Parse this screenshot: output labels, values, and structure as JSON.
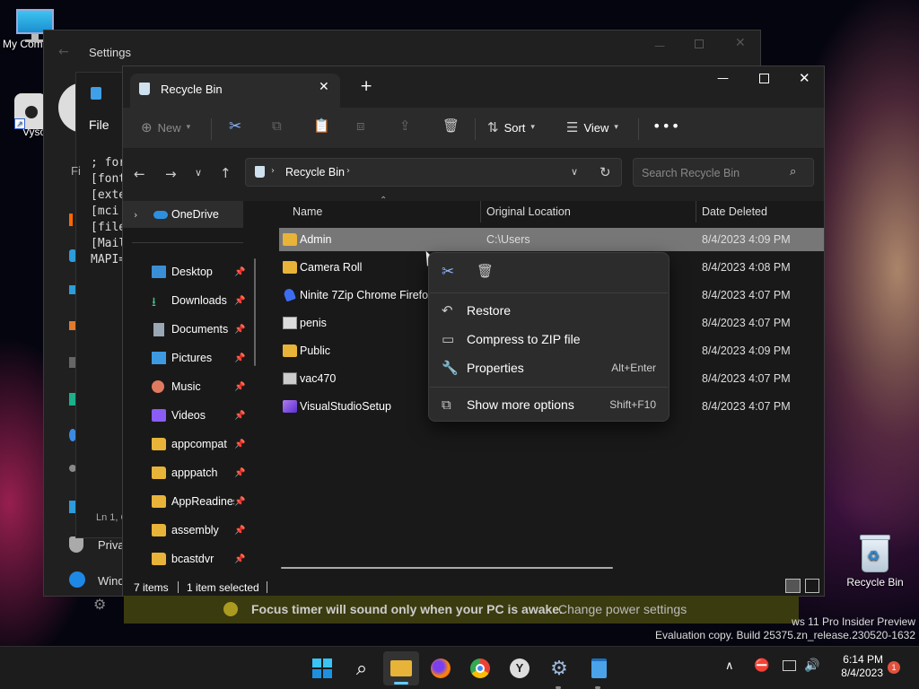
{
  "desktop": {
    "icons": [
      {
        "label": "My Com"
      },
      {
        "label": "Vyso"
      },
      {
        "label": "Recycle Bin"
      }
    ],
    "watermark_line1": "ws 11 Pro Insider Preview",
    "watermark_line2": "Evaluation copy. Build 25375.zn_release.230520-1632"
  },
  "settings_window": {
    "title": "Settings",
    "sidebar_fragments": [
      "Priva",
      "Wind"
    ]
  },
  "notepad_window": {
    "menu_file": "File",
    "menu_fi": "Fi",
    "lines": [
      "; for",
      "[font",
      "[exte",
      "[mci",
      "[file",
      "[Mail",
      "MAPI="
    ],
    "status": "Ln 1, C"
  },
  "explorer": {
    "tab_title": "Recycle Bin",
    "toolbar": {
      "new_label": "New",
      "sort_label": "Sort",
      "view_label": "View"
    },
    "address": {
      "path": "Recycle Bin",
      "search_placeholder": "Search Recycle Bin"
    },
    "nav": {
      "onedrive": "OneDrive",
      "items": [
        {
          "label": "Desktop",
          "icon": "desktop-icon"
        },
        {
          "label": "Downloads",
          "icon": "download-icon"
        },
        {
          "label": "Documents",
          "icon": "document-icon"
        },
        {
          "label": "Pictures",
          "icon": "picture-icon"
        },
        {
          "label": "Music",
          "icon": "music-icon"
        },
        {
          "label": "Videos",
          "icon": "video-icon"
        },
        {
          "label": "appcompat",
          "icon": "folder-icon"
        },
        {
          "label": "apppatch",
          "icon": "folder-icon"
        },
        {
          "label": "AppReadiness",
          "icon": "folder-icon"
        },
        {
          "label": "assembly",
          "icon": "folder-icon"
        },
        {
          "label": "bcastdvr",
          "icon": "folder-icon"
        }
      ]
    },
    "columns": {
      "name": "Name",
      "location": "Original Location",
      "date": "Date Deleted"
    },
    "rows": [
      {
        "name": "Admin",
        "location": "C:\\Users",
        "date": "8/4/2023 4:09 PM",
        "icon": "folder-icon"
      },
      {
        "name": "Camera Roll",
        "location": "",
        "date": "8/4/2023 4:08 PM",
        "icon": "folder-icon"
      },
      {
        "name": "Ninite 7Zip Chrome Firefox",
        "location": "",
        "date": "8/4/2023 4:07 PM",
        "icon": "ninite-icon"
      },
      {
        "name": "penis",
        "location": "",
        "date": "8/4/2023 4:07 PM",
        "icon": "image-file-icon"
      },
      {
        "name": "Public",
        "location": "",
        "date": "8/4/2023 4:09 PM",
        "icon": "folder-icon"
      },
      {
        "name": "vac470",
        "location": "",
        "date": "8/4/2023 4:07 PM",
        "icon": "app-file-icon"
      },
      {
        "name": "VisualStudioSetup",
        "location": "",
        "date": "8/4/2023 4:07 PM",
        "icon": "visual-studio-icon"
      }
    ],
    "status": {
      "count": "7 items",
      "selected": "1 item selected"
    }
  },
  "context_menu": {
    "items": [
      {
        "label": "Restore",
        "shortcut": "",
        "icon": "restore-icon"
      },
      {
        "label": "Compress to ZIP file",
        "shortcut": "",
        "icon": "zip-icon"
      },
      {
        "label": "Properties",
        "shortcut": "Alt+Enter",
        "icon": "properties-icon"
      },
      {
        "label": "Show more options",
        "shortcut": "Shift+F10",
        "icon": "more-options-icon"
      }
    ]
  },
  "notification": {
    "message": "Focus timer will sound only when your PC is awake.",
    "link": "Change power settings"
  },
  "taskbar": {
    "time": "6:14 PM",
    "date": "8/4/2023",
    "badge": "1"
  },
  "colors": {
    "accent": "#60cdff",
    "folder": "#e8b339",
    "selection": "#777777"
  }
}
